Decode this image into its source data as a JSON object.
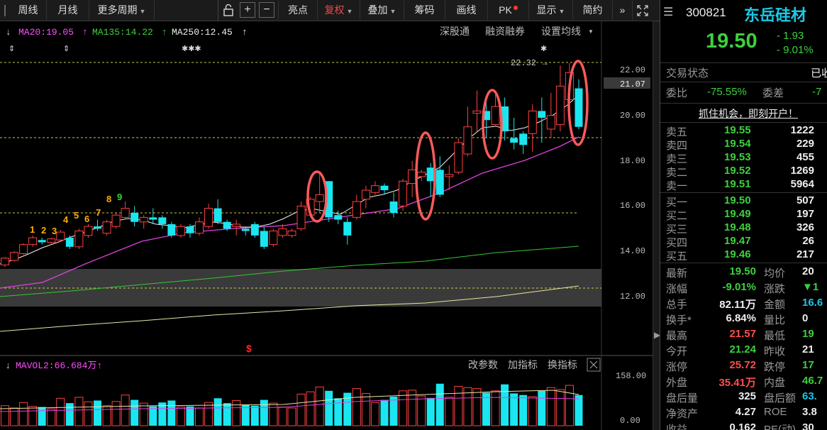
{
  "toolbar": {
    "week": "周线",
    "month": "月线",
    "more_periods": "更多周期",
    "bright": "亮点",
    "fuquan": "复权",
    "overlay": "叠加",
    "chips": "筹码",
    "draw": "画线",
    "pk": "PK",
    "display": "显示",
    "simple": "简约",
    "plus": "+",
    "minus": "−",
    "ffwd": "»"
  },
  "ma_line": {
    "ma20": "MA20:19.05",
    "ma135": "MA135:14.22",
    "ma250": "MA250:12.45"
  },
  "tabs": {
    "shengu": "深股通",
    "rzrq": "融资融券",
    "set_ma": "设置均线"
  },
  "price_axis": {
    "ticks": [
      "22.00",
      "21.07",
      "20.00",
      "18.00",
      "16.00",
      "14.00",
      "12.00"
    ],
    "current": "21.07"
  },
  "peak_label": "22.32",
  "seq_numbers": [
    "1",
    "2",
    "3",
    "4",
    "5",
    "6",
    "7",
    "8",
    "9"
  ],
  "vol_head": {
    "mavol": "MAVOL2:66.684万",
    "param": "改参数",
    "add_ind": "加指标",
    "switch_ind": "换指标"
  },
  "vol_axis": {
    "top": "158.00",
    "bottom": "0.00"
  },
  "quote": {
    "code": "300821",
    "name": "东岳硅材",
    "price": "19.50",
    "change": "- 1.93",
    "change_pct": "- 9.01%",
    "trade_state_label": "交易状态",
    "trade_state": "已收",
    "weibi_label": "委比",
    "weibi": "-75.55%",
    "weicha_label": "委差",
    "weicha": "-7",
    "promo": "抓住机会，即刻开户！",
    "sells": [
      {
        "label": "卖五",
        "price": "19.55",
        "vol": "1222"
      },
      {
        "label": "卖四",
        "price": "19.54",
        "vol": "229"
      },
      {
        "label": "卖三",
        "price": "19.53",
        "vol": "455"
      },
      {
        "label": "卖二",
        "price": "19.52",
        "vol": "1269"
      },
      {
        "label": "卖一",
        "price": "19.51",
        "vol": "5964"
      }
    ],
    "buys": [
      {
        "label": "买一",
        "price": "19.50",
        "vol": "507"
      },
      {
        "label": "买二",
        "price": "19.49",
        "vol": "197"
      },
      {
        "label": "买三",
        "price": "19.48",
        "vol": "326"
      },
      {
        "label": "买四",
        "price": "19.47",
        "vol": "26"
      },
      {
        "label": "买五",
        "price": "19.46",
        "vol": "217"
      }
    ],
    "stats": [
      {
        "l1": "最新",
        "v1": "19.50",
        "c1": "dn",
        "l2": "均价",
        "v2": "20",
        "c2": "wt"
      },
      {
        "l1": "涨幅",
        "v1": "-9.01%",
        "c1": "dn",
        "l2": "涨跌",
        "v2": "▼1",
        "c2": "dn"
      },
      {
        "l1": "总手",
        "v1": "82.11万",
        "c1": "wt",
        "l2": "金额",
        "v2": "16.6",
        "c2": "cy"
      },
      {
        "l1": "换手*",
        "v1": "6.84%",
        "c1": "wt",
        "l2": "量比",
        "v2": "0",
        "c2": "wt"
      },
      {
        "l1": "最高",
        "v1": "21.57",
        "c1": "up",
        "l2": "最低",
        "v2": "19",
        "c2": "dn"
      },
      {
        "l1": "今开",
        "v1": "21.24",
        "c1": "dn",
        "l2": "昨收",
        "v2": "21",
        "c2": "wt"
      },
      {
        "l1": "涨停",
        "v1": "25.72",
        "c1": "up",
        "l2": "跌停",
        "v2": "17",
        "c2": "dn"
      },
      {
        "l1": "外盘",
        "v1": "35.41万",
        "c1": "up",
        "l2": "内盘",
        "v2": "46.7",
        "c2": "dn"
      },
      {
        "l1": "盘后量",
        "v1": "325",
        "c1": "wt",
        "l2": "盘后额",
        "v2": "63.",
        "c2": "cy"
      },
      {
        "l1": "净资产",
        "v1": "4.27",
        "c1": "wt",
        "l2": "ROE",
        "v2": "3.8",
        "c2": "wt"
      },
      {
        "l1": "收益",
        "v1": "0.162",
        "c1": "wt",
        "l2": "PE(动)",
        "v2": "30",
        "c2": "wt"
      }
    ]
  },
  "chart_data": {
    "type": "candlestick",
    "price_range": [
      11.5,
      22.8
    ],
    "ma_labels": [
      "MA20",
      "MA135",
      "MA250"
    ],
    "candles": [
      [
        13.4,
        13.7,
        13.3,
        13.75
      ],
      [
        13.6,
        13.95,
        13.55,
        14.0
      ],
      [
        13.9,
        14.3,
        13.85,
        14.35
      ],
      [
        14.3,
        14.6,
        14.2,
        14.7
      ],
      [
        14.5,
        14.4,
        14.3,
        14.6
      ],
      [
        14.4,
        14.55,
        14.3,
        14.6
      ],
      [
        14.5,
        14.85,
        14.4,
        14.95
      ],
      [
        14.6,
        14.2,
        14.1,
        14.7
      ],
      [
        14.2,
        14.9,
        14.1,
        15.0
      ],
      [
        14.7,
        15.1,
        14.6,
        15.2
      ],
      [
        15.1,
        15.0,
        14.9,
        15.4
      ],
      [
        14.8,
        15.3,
        14.7,
        15.4
      ],
      [
        15.1,
        15.6,
        15.0,
        15.7
      ],
      [
        15.5,
        15.9,
        15.4,
        16.2
      ],
      [
        15.7,
        15.3,
        15.1,
        16.0
      ],
      [
        15.3,
        15.5,
        15.0,
        15.6
      ],
      [
        15.5,
        15.4,
        15.2,
        15.9
      ],
      [
        15.5,
        15.2,
        15.0,
        15.6
      ],
      [
        15.2,
        14.7,
        14.6,
        15.3
      ],
      [
        14.7,
        15.1,
        14.6,
        15.2
      ],
      [
        15.1,
        14.8,
        14.6,
        15.2
      ],
      [
        14.8,
        15.3,
        14.7,
        15.5
      ],
      [
        15.1,
        15.9,
        15.0,
        16.1
      ],
      [
        15.9,
        15.3,
        15.2,
        16.3
      ],
      [
        15.3,
        15.0,
        14.9,
        15.4
      ],
      [
        15.1,
        15.2,
        14.7,
        15.4
      ],
      [
        15.0,
        14.9,
        14.7,
        15.1
      ],
      [
        15.2,
        14.7,
        14.6,
        15.3
      ],
      [
        14.9,
        14.2,
        14.1,
        15.1
      ],
      [
        14.3,
        14.9,
        14.2,
        15.0
      ],
      [
        14.7,
        15.0,
        14.6,
        15.2
      ],
      [
        14.7,
        14.9,
        14.6,
        15.0
      ],
      [
        15.0,
        16.0,
        14.9,
        16.2
      ],
      [
        15.6,
        16.3,
        15.5,
        16.4
      ],
      [
        16.2,
        16.5,
        15.7,
        17.5
      ],
      [
        17.1,
        15.5,
        15.3,
        17.1
      ],
      [
        15.6,
        15.4,
        15.2,
        15.8
      ],
      [
        15.3,
        14.7,
        14.3,
        15.5
      ],
      [
        15.5,
        16.2,
        15.4,
        16.5
      ],
      [
        16.3,
        16.7,
        15.9,
        16.9
      ],
      [
        16.6,
        16.9,
        16.5,
        17.1
      ],
      [
        16.9,
        16.7,
        16.5,
        17.0
      ],
      [
        16.2,
        15.7,
        15.5,
        16.6
      ],
      [
        16.0,
        17.1,
        15.8,
        17.2
      ],
      [
        17.0,
        17.6,
        16.4,
        18.0
      ],
      [
        17.3,
        17.5,
        17.1,
        17.6
      ],
      [
        17.7,
        17.1,
        16.4,
        17.9
      ],
      [
        17.6,
        16.5,
        16.4,
        18.2
      ],
      [
        17.3,
        17.4,
        16.7,
        17.8
      ],
      [
        17.5,
        18.8,
        17.4,
        19.0
      ],
      [
        18.3,
        19.5,
        18.2,
        20.4
      ],
      [
        20.1,
        20.2,
        19.3,
        21.1
      ],
      [
        20.2,
        19.8,
        19.0,
        20.8
      ],
      [
        19.6,
        20.4,
        19.5,
        21.0
      ],
      [
        20.4,
        19.3,
        18.9,
        20.8
      ],
      [
        19.0,
        18.8,
        18.5,
        19.9
      ],
      [
        19.2,
        18.7,
        18.3,
        19.3
      ],
      [
        19.2,
        20.2,
        18.4,
        20.5
      ],
      [
        20.2,
        19.9,
        18.8,
        20.8
      ],
      [
        19.4,
        20.0,
        19.0,
        21.0
      ],
      [
        19.6,
        21.3,
        19.3,
        22.2
      ],
      [
        20.7,
        21.9,
        20.4,
        22.32
      ],
      [
        21.2,
        19.5,
        19.4,
        21.6
      ]
    ],
    "volume_range": [
      0,
      158
    ],
    "volumes": [
      62,
      55,
      72,
      60,
      58,
      52,
      85,
      70,
      88,
      74,
      78,
      62,
      75,
      95,
      80,
      70,
      60,
      72,
      78,
      58,
      60,
      55,
      72,
      85,
      70,
      78,
      65,
      62,
      80,
      70,
      58,
      55,
      98,
      105,
      120,
      108,
      85,
      102,
      115,
      100,
      72,
      80,
      90,
      108,
      110,
      92,
      86,
      130,
      88,
      122,
      118,
      115,
      102,
      108,
      128,
      100,
      95,
      90,
      108,
      118,
      112,
      125,
      95
    ]
  }
}
